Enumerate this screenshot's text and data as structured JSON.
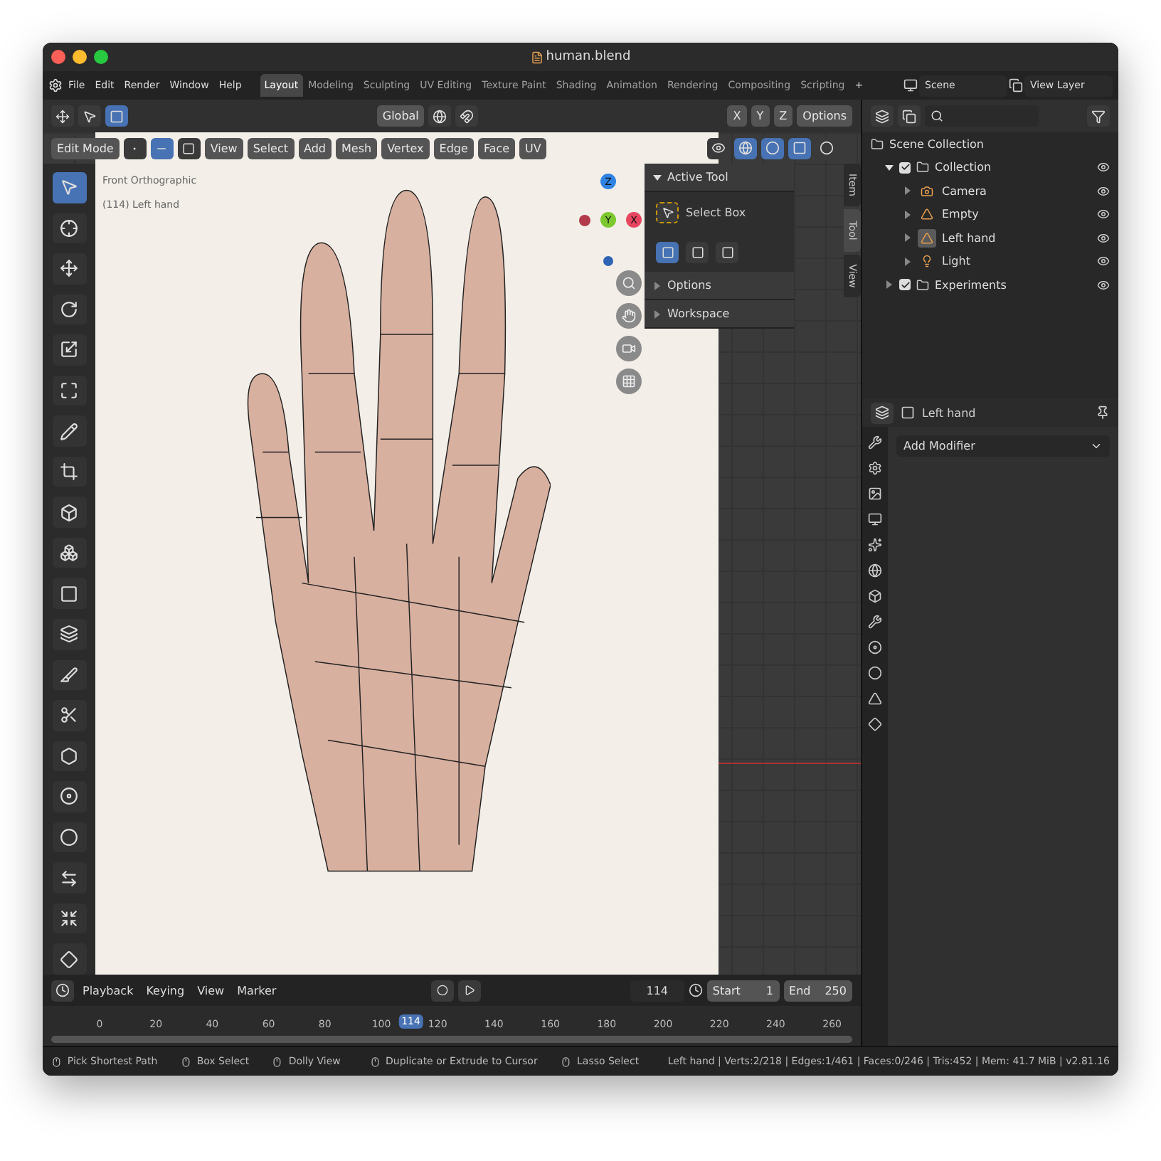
{
  "window": {
    "title": "human.blend"
  },
  "menu": [
    "File",
    "Edit",
    "Render",
    "Window",
    "Help"
  ],
  "workspaces": [
    {
      "label": "Layout",
      "selected": true
    },
    {
      "label": "Modeling",
      "selected": false
    },
    {
      "label": "Sculpting",
      "selected": false
    },
    {
      "label": "UV Editing",
      "selected": false
    },
    {
      "label": "Texture Paint",
      "selected": false
    },
    {
      "label": "Shading",
      "selected": false
    },
    {
      "label": "Animation",
      "selected": false
    },
    {
      "label": "Rendering",
      "selected": false
    },
    {
      "label": "Compositing",
      "selected": false
    },
    {
      "label": "Scripting",
      "selected": false
    }
  ],
  "add_workspace": "+",
  "scene": "Scene",
  "view_layer": "View Layer",
  "tool_header": {
    "orientation": "Global",
    "axes": [
      "X",
      "Y",
      "Z"
    ],
    "options": "Options"
  },
  "viewport_header": {
    "mode": "Edit Mode",
    "select_modes": [
      {
        "kind": "vertex",
        "selected": false
      },
      {
        "kind": "edge",
        "selected": true
      },
      {
        "kind": "face",
        "selected": false
      }
    ],
    "menus": [
      "View",
      "Select",
      "Add",
      "Mesh",
      "Vertex",
      "Edge",
      "Face",
      "UV"
    ]
  },
  "viewport": {
    "view_name": "Front Orthographic",
    "object_label": "(114) Left hand",
    "gizmo_axes": [
      "Z",
      "Y",
      "X"
    ]
  },
  "sidebar": {
    "tabs": [
      {
        "label": "Item",
        "selected": false
      },
      {
        "label": "Tool",
        "selected": true
      },
      {
        "label": "View",
        "selected": false
      }
    ],
    "panels": [
      {
        "title": "Active Tool",
        "expanded": true
      },
      {
        "title": "Options",
        "expanded": false
      },
      {
        "title": "Workspace",
        "expanded": false
      }
    ],
    "active_tool": "Select Box"
  },
  "outliner": {
    "root": "Scene Collection",
    "items": [
      {
        "label": "Collection",
        "checked": true,
        "expanded": true,
        "children": [
          {
            "label": "Camera",
            "kind": "camera",
            "selected": false
          },
          {
            "label": "Empty",
            "kind": "empty",
            "selected": false
          },
          {
            "label": "Left hand",
            "kind": "mesh",
            "selected": true
          },
          {
            "label": "Light",
            "kind": "light",
            "selected": false
          }
        ]
      },
      {
        "label": "Experiments",
        "checked": true,
        "expanded": false
      }
    ]
  },
  "properties": {
    "object": "Left hand",
    "add_modifier": "Add Modifier"
  },
  "timeline": {
    "menus": [
      "Playback",
      "Keying",
      "View",
      "Marker"
    ],
    "current_frame": "114",
    "start_label": "Start",
    "start": "1",
    "end_label": "End",
    "end": "250",
    "ticks": [
      "0",
      "20",
      "40",
      "60",
      "80",
      "100",
      "120",
      "140",
      "160",
      "180",
      "200",
      "220",
      "240",
      "260"
    ],
    "playhead": "114"
  },
  "status_bar": {
    "hints": [
      "Pick Shortest Path",
      "Box Select",
      "Dolly View",
      "Duplicate or Extrude to Cursor",
      "Lasso Select"
    ],
    "stats": "Left hand | Verts:2/218 | Edges:1/461 | Faces:0/246 | Tris:452 | Mem: 41.7 MiB | v2.81.16"
  }
}
